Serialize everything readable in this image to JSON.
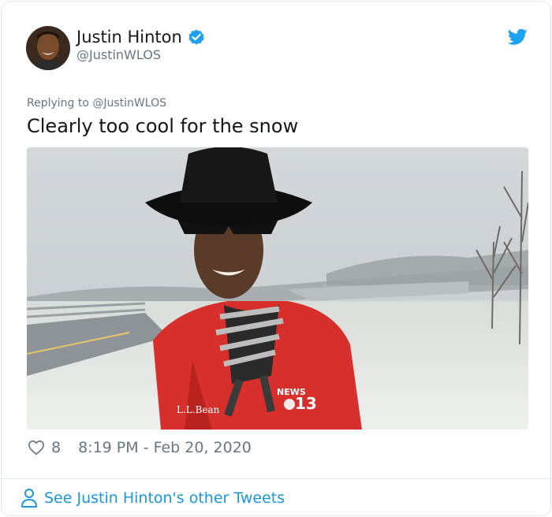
{
  "author": {
    "name": "Justin Hinton",
    "handle": "@JustinWLOS",
    "verified": true
  },
  "tweet": {
    "reply_prefix": "Replying to @JustinWLOS",
    "text": "Clearly too cool for the snow",
    "likes": "8",
    "timestamp": "8:19 PM - Feb 20, 2020"
  },
  "media": {
    "jacket_brand": "L.L.Bean",
    "station_logo_top": "NEWS",
    "station_logo_num": "13"
  },
  "footer": {
    "see_more": "See Justin Hinton's other Tweets"
  },
  "colors": {
    "accent": "#1b95e0",
    "verified": "#1da1f2",
    "muted": "#657786",
    "text": "#14171a"
  },
  "icons": [
    "verified-badge-icon",
    "twitter-bird-icon",
    "heart-icon",
    "person-icon"
  ]
}
